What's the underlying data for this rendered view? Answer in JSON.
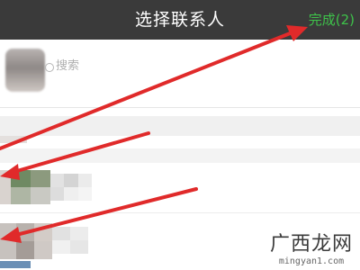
{
  "header": {
    "title": "选择联系人",
    "done_label": "完成(2)"
  },
  "search": {
    "placeholder": "搜索",
    "selected_count_avatars": 1
  },
  "contacts": {
    "visible_rows": 3,
    "names_pixelated": true
  },
  "annotations": {
    "arrow_color": "#e02a2a",
    "arrow_count": 3
  },
  "watermark": {
    "name": "广西龙网",
    "url": "mingyan1.com"
  },
  "colors": {
    "titlebar_bg": "#3a3a3a",
    "done_green": "#3ec24a",
    "title_text": "#ffffff"
  }
}
